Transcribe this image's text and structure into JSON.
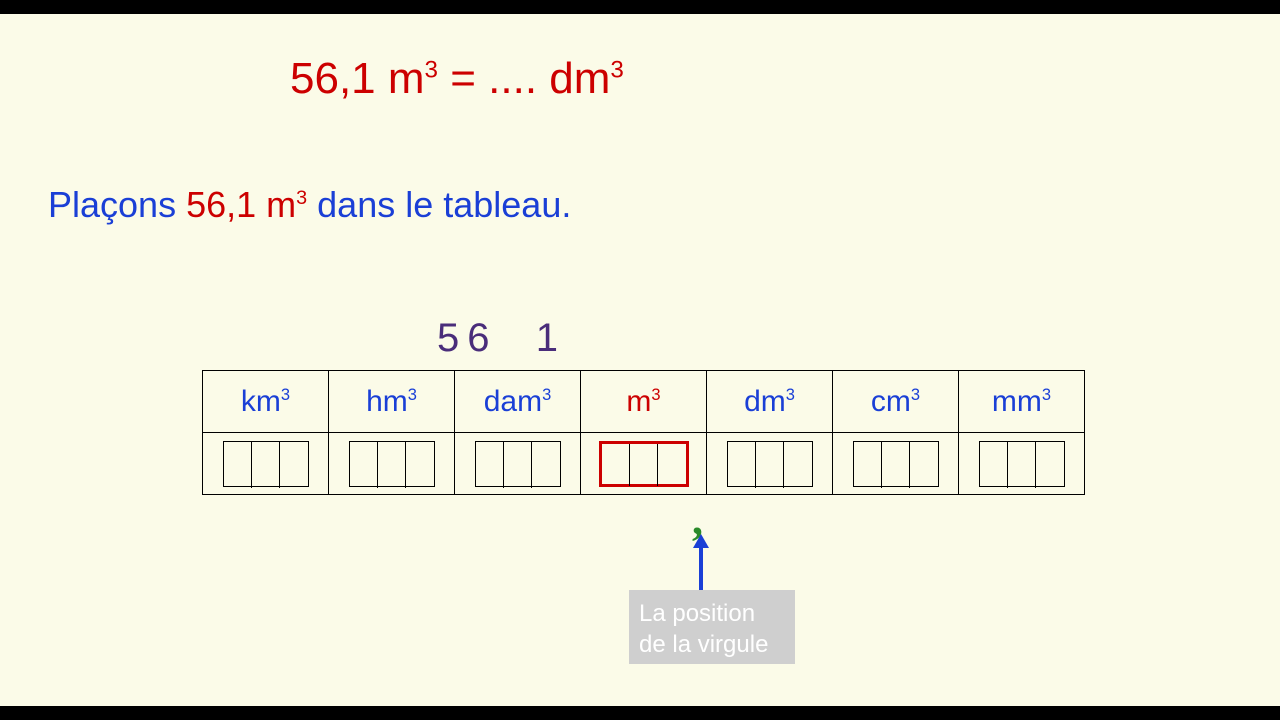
{
  "equation": {
    "lhs_value": "56,1",
    "lhs_unit_base": "m",
    "lhs_unit_exp": "3",
    "equals": " = ",
    "dots": "....",
    "rhs_unit_base": "dm",
    "rhs_unit_exp": "3"
  },
  "instruction": {
    "pre": "Plaçons ",
    "value": "56,1 m",
    "value_exp": "3",
    "post": " dans le tableau."
  },
  "above_number_a": "56",
  "above_number_b": "1",
  "units": [
    {
      "base": "km",
      "exp": "3",
      "highlight": false
    },
    {
      "base": "hm",
      "exp": "3",
      "highlight": false
    },
    {
      "base": "dam",
      "exp": "3",
      "highlight": false
    },
    {
      "base": "m",
      "exp": "3",
      "highlight": true
    },
    {
      "base": "dm",
      "exp": "3",
      "highlight": false
    },
    {
      "base": "cm",
      "exp": "3",
      "highlight": false
    },
    {
      "base": "mm",
      "exp": "3",
      "highlight": false
    }
  ],
  "comma_glyph": ",",
  "caption_line1": "La position",
  "caption_line2": "de la virgule"
}
